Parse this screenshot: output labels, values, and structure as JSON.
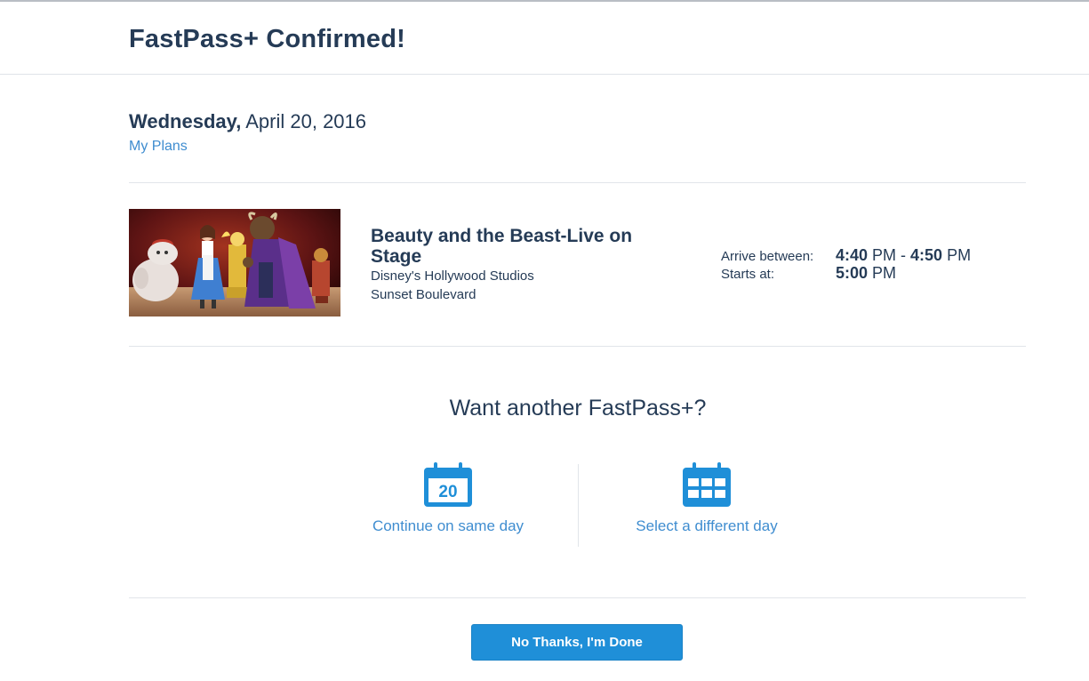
{
  "header": {
    "title": "FastPass+ Confirmed!"
  },
  "date": {
    "weekday": "Wednesday,",
    "full_date": "April 20, 2016",
    "my_plans_link": "My Plans"
  },
  "experience": {
    "title": "Beauty and the Beast-Live on Stage",
    "park": "Disney's Hollywood Studios",
    "area": "Sunset Boulevard",
    "image_alt": "Beauty and the Beast stage show"
  },
  "times": {
    "arrive_label": "Arrive between:",
    "arrive_start": "4:40",
    "arrive_start_suffix": " PM - ",
    "arrive_end": "4:50",
    "arrive_end_suffix": " PM",
    "starts_label": "Starts at:",
    "starts_value": "5:00",
    "starts_suffix": " PM"
  },
  "another": {
    "heading": "Want another FastPass+?",
    "same_day_label": "Continue on same day",
    "same_day_icon_number": "20",
    "different_day_label": "Select a different day"
  },
  "done_button": {
    "label": "No Thanks, I'm Done"
  },
  "colors": {
    "accent": "#1f8fd8",
    "link": "#3f8dd0",
    "text": "#253b56"
  }
}
